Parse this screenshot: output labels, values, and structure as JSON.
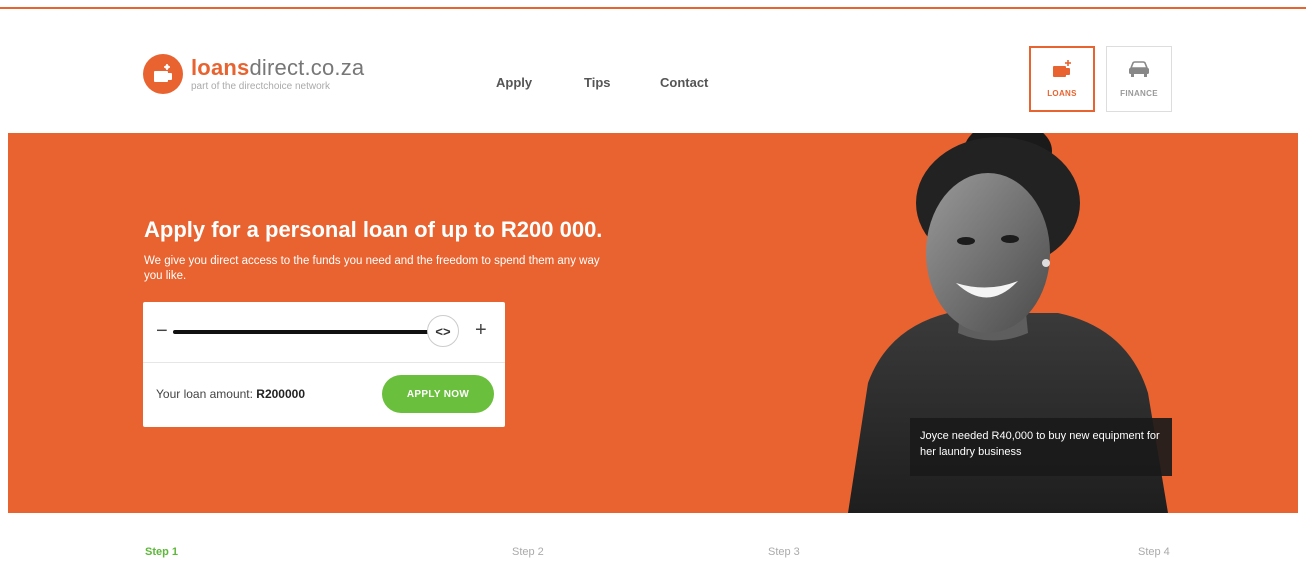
{
  "brand": {
    "name_accent": "loans",
    "name_rest": "direct.co.za",
    "tagline": "part of the directchoice network",
    "accent_color": "#e8632f"
  },
  "nav": {
    "items": [
      {
        "label": "Apply"
      },
      {
        "label": "Tips"
      },
      {
        "label": "Contact"
      }
    ]
  },
  "products": [
    {
      "label": "LOANS",
      "icon": "wallet-icon",
      "active": true
    },
    {
      "label": "FINANCE",
      "icon": "car-icon",
      "active": false
    }
  ],
  "hero": {
    "title": "Apply for a personal loan of up to R200 000.",
    "subtitle": "We give you direct access to the funds you need and the freedom to spend them any way you like.",
    "background_color": "#e8632f"
  },
  "loan_form": {
    "minus_symbol": "−",
    "plus_symbol": "+",
    "knob_symbol": "<>",
    "slider_fraction": 1.0,
    "amount_label": "Your loan amount: ",
    "amount_value": "R200000",
    "apply_label": "APPLY NOW",
    "apply_color": "#6abf3c"
  },
  "testimonial": {
    "caption": "Joyce needed R40,000 to buy new equipment for her laundry business"
  },
  "steps": [
    {
      "label": "Step 1",
      "active": true
    },
    {
      "label": "Step 2",
      "active": false
    },
    {
      "label": "Step 3",
      "active": false
    },
    {
      "label": "Step 4",
      "active": false
    }
  ]
}
